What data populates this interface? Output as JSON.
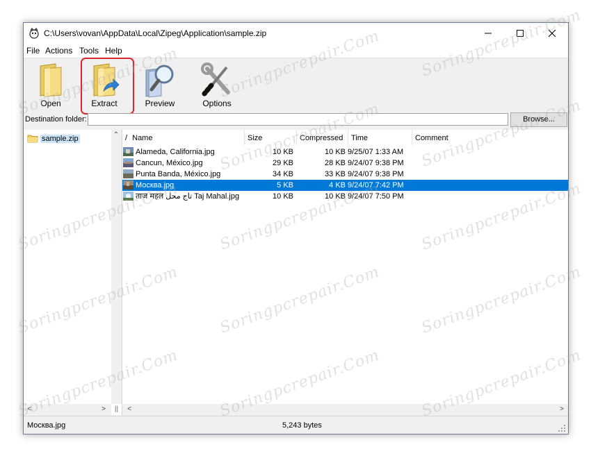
{
  "window": {
    "title": "C:\\Users\\vovan\\AppData\\Local\\Zipeg\\Application\\sample.zip"
  },
  "menu": [
    "File",
    "Actions",
    "Tools",
    "Help"
  ],
  "toolbar": {
    "open": "Open",
    "extract": "Extract",
    "preview": "Preview",
    "options": "Options"
  },
  "destination": {
    "label": "Destination folder:",
    "value": "",
    "browse": "Browse..."
  },
  "tree": {
    "items": [
      {
        "label": "sample.zip"
      }
    ]
  },
  "columns": {
    "sort_indicator": "/",
    "name": "Name",
    "size": "Size",
    "compressed": "Compressed",
    "time": "Time",
    "comment": "Comment"
  },
  "files": [
    {
      "name": "Alameda, California.jpg",
      "size": "10 KB",
      "compressed": "10 KB",
      "time": "9/25/07 1:33 AM",
      "comment": "",
      "selected": false
    },
    {
      "name": "Cancun, México.jpg",
      "size": "29 KB",
      "compressed": "28 KB",
      "time": "9/24/07 9:38 PM",
      "comment": "",
      "selected": false
    },
    {
      "name": "Punta Banda, México.jpg",
      "size": "34 KB",
      "compressed": "33 KB",
      "time": "9/24/07 9:38 PM",
      "comment": "",
      "selected": false
    },
    {
      "name": "Москва.jpg",
      "size": "5 KB",
      "compressed": "4 KB",
      "time": "9/24/07 7:42 PM",
      "comment": "",
      "selected": true
    },
    {
      "name": "ताज महल تاج محل Taj Mahal.jpg",
      "size": "10 KB",
      "compressed": "10 KB",
      "time": "9/24/07 7:50 PM",
      "comment": "",
      "selected": false
    }
  ],
  "status": {
    "selected_name": "Москва.jpg",
    "selected_size": "5,243 bytes"
  },
  "watermark": "Soringpcrepair.Com",
  "colors": {
    "selection": "#0078d7",
    "highlight_border": "#d9262d"
  }
}
